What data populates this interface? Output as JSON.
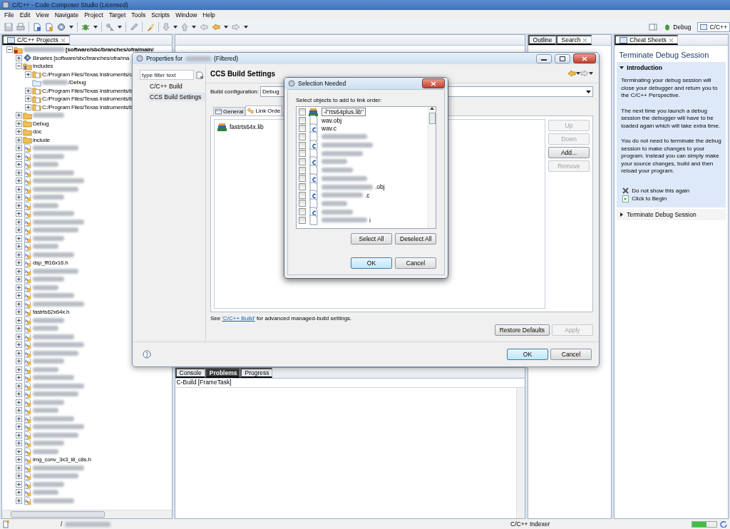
{
  "window": {
    "title": "C/C++ - Code Composer Studio (Licensed)"
  },
  "menu": [
    "File",
    "Edit",
    "View",
    "Navigate",
    "Project",
    "Target",
    "Tools",
    "Scripts",
    "Window",
    "Help"
  ],
  "perspectives": [
    {
      "label": "Debug",
      "selected": false
    },
    {
      "label": "C/C++",
      "selected": true
    }
  ],
  "project_explorer": {
    "title": "C/C++ Projects",
    "tree": [
      {
        "kind": "project",
        "label": "[software/sbc/branches/ofra/main/",
        "blurred": true,
        "expanded": true,
        "children": [
          {
            "kind": "binaries",
            "label": "Binaries [software/sbc/branches/ofra/ma",
            "expanded": false
          },
          {
            "kind": "includes",
            "label": "Includes",
            "expanded": true,
            "children": [
              {
                "kind": "path",
                "label": "C:/Program Files/Texas Instruments/c",
                "expanded": false
              },
              {
                "kind": "link",
                "label": "/Debug",
                "blurred": true
              },
              {
                "kind": "path",
                "label": "C:/Program Files/Texas Instruments/b",
                "expanded": false
              },
              {
                "kind": "path",
                "label": "C:/Program Files/Texas Instruments/b",
                "expanded": false
              },
              {
                "kind": "path",
                "label": "C:/Program Files/Texas Instruments/b",
                "expanded": false
              }
            ]
          },
          {
            "kind": "folder",
            "blurred": true,
            "expanded": false
          },
          {
            "kind": "folder",
            "label": "Debug",
            "expanded": false
          },
          {
            "kind": "folder",
            "label": "doc",
            "expanded": false
          },
          {
            "kind": "folder",
            "label": "include",
            "expanded": false
          },
          {
            "kind": "header",
            "blurred": true,
            "expanded": false
          },
          {
            "kind": "header",
            "blurred": true,
            "expanded": false
          },
          {
            "kind": "header",
            "blurred": true,
            "expanded": false
          },
          {
            "kind": "header",
            "blurred": true,
            "expanded": false
          },
          {
            "kind": "header",
            "blurred": true,
            "expanded": false
          },
          {
            "kind": "header",
            "blurred": true,
            "expanded": false
          },
          {
            "kind": "header",
            "blurred": true,
            "expanded": false
          },
          {
            "kind": "header",
            "blurred": true,
            "expanded": false
          },
          {
            "kind": "header",
            "blurred": true,
            "expanded": false
          },
          {
            "kind": "header",
            "blurred": true,
            "expanded": false
          },
          {
            "kind": "header",
            "blurred": true,
            "expanded": false
          },
          {
            "kind": "header",
            "blurred": true,
            "expanded": false
          },
          {
            "kind": "header",
            "blurred": true,
            "expanded": false
          },
          {
            "kind": "header",
            "blurred": true,
            "expanded": false
          },
          {
            "kind": "header",
            "label": "dsp_fft16x16.h",
            "expanded": false
          },
          {
            "kind": "header",
            "blurred": true,
            "expanded": false
          },
          {
            "kind": "header",
            "blurred": true,
            "expanded": false
          },
          {
            "kind": "header",
            "blurred": true,
            "expanded": false
          },
          {
            "kind": "header",
            "blurred": true,
            "expanded": false
          },
          {
            "kind": "header",
            "blurred": true,
            "expanded": false
          },
          {
            "kind": "header",
            "label": "fastrts62x64x.h",
            "expanded": false
          },
          {
            "kind": "header",
            "blurred": true,
            "expanded": false
          },
          {
            "kind": "header",
            "blurred": true,
            "expanded": false
          },
          {
            "kind": "header",
            "blurred": true,
            "expanded": false
          },
          {
            "kind": "header",
            "blurred": true,
            "expanded": false
          },
          {
            "kind": "header",
            "blurred": true,
            "expanded": false
          },
          {
            "kind": "header",
            "blurred": true,
            "expanded": false
          },
          {
            "kind": "header",
            "blurred": true,
            "expanded": false
          },
          {
            "kind": "header",
            "blurred": true,
            "expanded": false
          },
          {
            "kind": "header",
            "blurred": true,
            "expanded": false
          },
          {
            "kind": "header",
            "blurred": true,
            "expanded": false
          },
          {
            "kind": "header",
            "blurred": true,
            "expanded": false
          },
          {
            "kind": "header",
            "blurred": true,
            "expanded": false
          },
          {
            "kind": "header",
            "blurred": true,
            "expanded": false
          },
          {
            "kind": "header",
            "blurred": true,
            "expanded": false
          },
          {
            "kind": "header",
            "blurred": true,
            "expanded": false
          },
          {
            "kind": "header",
            "blurred": true,
            "expanded": false
          },
          {
            "kind": "header",
            "blurred": true,
            "expanded": false
          },
          {
            "kind": "header",
            "label": "img_conv_3x3_i8_c8s.h",
            "expanded": false
          },
          {
            "kind": "header",
            "blurred": true,
            "expanded": false
          },
          {
            "kind": "header",
            "blurred": true,
            "expanded": false
          },
          {
            "kind": "header",
            "blurred": true,
            "expanded": false
          },
          {
            "kind": "header",
            "blurred": true,
            "expanded": false
          },
          {
            "kind": "header",
            "blurred": true,
            "expanded": false
          }
        ]
      }
    ]
  },
  "console": {
    "tabs": [
      {
        "label": "Console",
        "selected": false
      },
      {
        "label": "Problems",
        "selected": true
      },
      {
        "label": "Progress",
        "selected": false
      }
    ],
    "subtitle": "C-Build [FrameTask]"
  },
  "side_tabs": [
    {
      "label": "Outline",
      "selected": false
    },
    {
      "label": "Search",
      "selected": true
    }
  ],
  "cheat_sheet": {
    "tab": "Cheat Sheets",
    "title": "Terminate Debug Session",
    "sections": [
      {
        "title": "Introduction",
        "expanded": true,
        "paragraphs": [
          "Terminating your debug session will close your debugger and return you to the C/C++ Perspective.",
          "The next time you launch a debug session the debugger will have to be loaded again which will take extra time.",
          "You do not need to terminate the debug session to make changes to your program. Instead you can simply make your source changes, build and then reload your program."
        ],
        "actions": [
          {
            "kind": "skip",
            "label": "Do not show this again"
          },
          {
            "kind": "begin",
            "label": "Click to Begin"
          }
        ]
      },
      {
        "title": "Terminate Debug Session",
        "expanded": false
      }
    ]
  },
  "properties_dialog": {
    "title_prefix": "Properties for",
    "title_suffix": "(Filtered)",
    "filter_placeholder": "type filter text",
    "nav": [
      {
        "label": "C/C++ Build",
        "selected": false
      },
      {
        "label": "CCS Build Settings",
        "selected": true
      }
    ],
    "heading": "CCS Build Settings",
    "config_label": "Build configuration:",
    "config_value": "Debug",
    "tabs": [
      {
        "label": "General",
        "selected": false
      },
      {
        "label": "Link Orde",
        "selected": true
      }
    ],
    "libraries": [
      "fastrts64x.lib"
    ],
    "side_buttons": [
      {
        "label": "Up",
        "disabled": true
      },
      {
        "label": "Down",
        "disabled": true
      },
      {
        "label": "Add...",
        "disabled": false
      },
      {
        "label": "Remove",
        "disabled": true
      }
    ],
    "note_before": "See ",
    "note_link": "'C/C++ Build'",
    "note_after": " for advanced managed-build settings.",
    "apply_buttons": [
      {
        "label": "Restore Defaults",
        "disabled": false
      },
      {
        "label": "Apply",
        "disabled": true
      }
    ],
    "ok": "OK",
    "cancel": "Cancel"
  },
  "selection_dialog": {
    "title": "Selection Needed",
    "prompt": "Select objects to add to link order:",
    "items": [
      {
        "kind": "lib",
        "label": "-l\"rts64plus.lib\"",
        "checked": false,
        "editing": true
      },
      {
        "kind": "obj",
        "label": "wav.obj",
        "checked": false
      },
      {
        "kind": "c",
        "label": "wav.c",
        "checked": false
      },
      {
        "kind": "obj",
        "blurred": true,
        "checked": false
      },
      {
        "kind": "c",
        "blurred": true,
        "checked": false
      },
      {
        "kind": "obj",
        "blurred": true,
        "checked": false
      },
      {
        "kind": "c",
        "blurred": true,
        "checked": false
      },
      {
        "kind": "obj",
        "blurred": true,
        "checked": false
      },
      {
        "kind": "c",
        "blurred": true,
        "checked": false
      },
      {
        "kind": "obj",
        "blurred": true,
        "label": ".obj",
        "checked": false
      },
      {
        "kind": "c",
        "blurred": true,
        "label": ".c",
        "checked": false
      },
      {
        "kind": "obj",
        "blurred": true,
        "checked": false
      },
      {
        "kind": "c",
        "blurred": true,
        "checked": false
      },
      {
        "kind": "obj",
        "blurred": true,
        "label": "i",
        "checked": false
      }
    ],
    "select_all": "Select All",
    "deselect_all": "Deselect All",
    "ok": "OK",
    "cancel": "Cancel"
  },
  "status_bar": {
    "path": "/",
    "task": "C/C++ Indexer",
    "level": 0.6
  }
}
